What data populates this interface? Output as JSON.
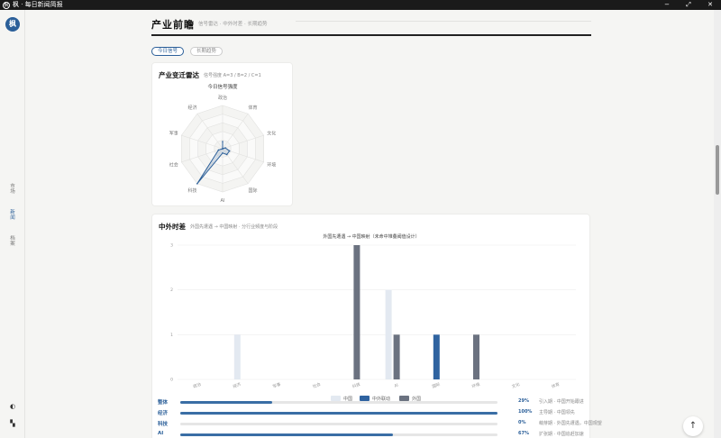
{
  "window": {
    "title": "枫 · 每日新闻简报",
    "icon": "app-icon",
    "controls": [
      "−",
      "⤢",
      "✕"
    ]
  },
  "sidebar": {
    "logo": "枫",
    "items": [
      {
        "label": "市场",
        "active": false
      },
      {
        "label": "新闻",
        "active": true
      },
      {
        "label": "档案",
        "active": false
      }
    ],
    "bottom_icons": [
      "theme-toggle-icon",
      "layout-icon"
    ]
  },
  "header": {
    "title": "产业前瞻",
    "subtitle": "信号雷达 · 中外时差 · 长期趋势"
  },
  "tabs": [
    {
      "label": "今日信号",
      "active": true
    },
    {
      "label": "长期趋势",
      "active": false
    }
  ],
  "radar_card": {
    "title": "产业变迁雷达",
    "subtitle": "信号强度 A=3 / B=2 / C=1",
    "chart_title": "今日信号强度"
  },
  "gap_card": {
    "title": "中外时差",
    "subtitle": "外国先遭遇 → 中国映射 · 分行业频度与阶段",
    "chart_title": "外国先遭遇 → 中国映射（未命中堆叠阈值设计）",
    "legend": [
      "中国",
      "中外联动",
      "外国"
    ]
  },
  "chart_data": [
    {
      "type": "radar",
      "title": "今日信号强度",
      "axes": [
        "政治",
        "体育",
        "文化",
        "环境",
        "国际",
        "AI",
        "科技",
        "社会",
        "军事",
        "经济"
      ],
      "values": [
        0.5,
        0,
        0.2,
        0.5,
        0.5,
        0.3,
        3,
        0.3,
        0,
        0
      ],
      "rmax": 3,
      "levels": 5,
      "color": "#2b5f99"
    },
    {
      "type": "bar",
      "title": "外国先遭遇 → 中国映射（未命中堆叠阈值设计）",
      "categories": [
        "政治",
        "经济",
        "军事",
        "社会",
        "科技",
        "AI",
        "国际",
        "环境",
        "文化",
        "体育"
      ],
      "series": [
        {
          "name": "中国",
          "color": "#e3e9f1",
          "values": [
            0,
            1,
            0,
            0,
            0,
            2,
            0,
            0,
            0,
            0
          ]
        },
        {
          "name": "中外联动",
          "color": "#2f63a0",
          "values": [
            0,
            0,
            0,
            0,
            0,
            0,
            1,
            0,
            0,
            0
          ]
        },
        {
          "name": "外国",
          "color": "#6b7280",
          "values": [
            0,
            0,
            0,
            0,
            3,
            1,
            0,
            1,
            0,
            0
          ]
        }
      ],
      "yticks": [
        "0",
        "1",
        "2",
        "3"
      ],
      "ylim": [
        0,
        3
      ]
    }
  ],
  "progress_rows": [
    {
      "label": "整体",
      "pct_text": "29%",
      "value": 0.29,
      "note": "引入期 · 中国开始跟进"
    },
    {
      "label": "经济",
      "pct_text": "100%",
      "value": 1.0,
      "note": "主导期 · 中国领先"
    },
    {
      "label": "科技",
      "pct_text": "0%",
      "value": 0.0,
      "note": "萌芽期 · 外国先遭遇，中国观望"
    },
    {
      "label": "AI",
      "pct_text": "67%",
      "value": 0.67,
      "note": "扩张期 · 中国追赶加速"
    }
  ],
  "fab": {
    "icon": "arrow-up-icon",
    "glyph": "↑"
  },
  "colors": {
    "accent": "#2b5f99",
    "foreign": "#6b7280",
    "china_light": "#e3e9f1"
  }
}
